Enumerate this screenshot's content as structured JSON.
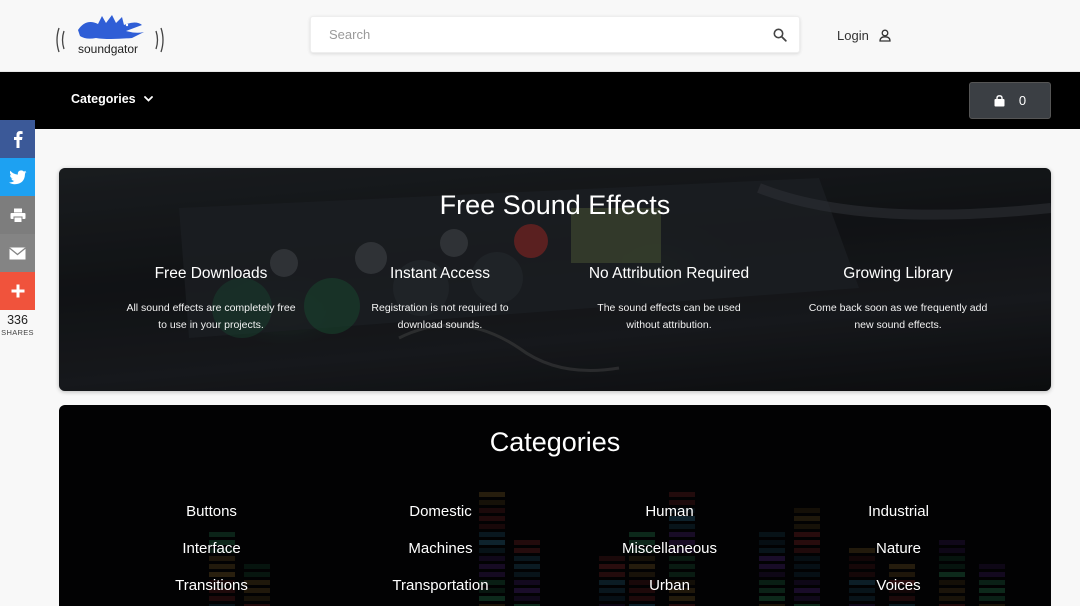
{
  "header": {
    "logo_text": "soundgator",
    "search_placeholder": "Search",
    "login_label": "Login"
  },
  "nav": {
    "categories_label": "Categories",
    "cart_count": "0"
  },
  "share": {
    "count": "336",
    "label": "SHARES",
    "buttons": [
      {
        "name": "facebook",
        "color": "#3b5998"
      },
      {
        "name": "twitter",
        "color": "#1da1f2"
      },
      {
        "name": "print",
        "color": "#7d7d7d"
      },
      {
        "name": "email",
        "color": "#848484"
      },
      {
        "name": "more",
        "color": "#f0533c"
      }
    ]
  },
  "hero": {
    "title": "Free Sound Effects",
    "features": [
      {
        "title": "Free Downloads",
        "desc_1": "All sound effects are completely free",
        "desc_2": "to use in your projects."
      },
      {
        "title": "Instant Access",
        "desc_1": "Registration is not required to",
        "desc_2": "download sounds."
      },
      {
        "title": "No Attribution Required",
        "desc_1": "The sound effects can be used",
        "desc_2": "without attribution."
      },
      {
        "title": "Growing Library",
        "desc_1": "Come back soon as we frequently add",
        "desc_2": "new sound effects."
      }
    ]
  },
  "categories": {
    "title": "Categories",
    "items": [
      "Buttons",
      "Domestic",
      "Human",
      "Industrial",
      "Interface",
      "Machines",
      "Miscellaneous",
      "Nature",
      "Transitions",
      "Transportation",
      "Urban",
      "Voices"
    ]
  }
}
